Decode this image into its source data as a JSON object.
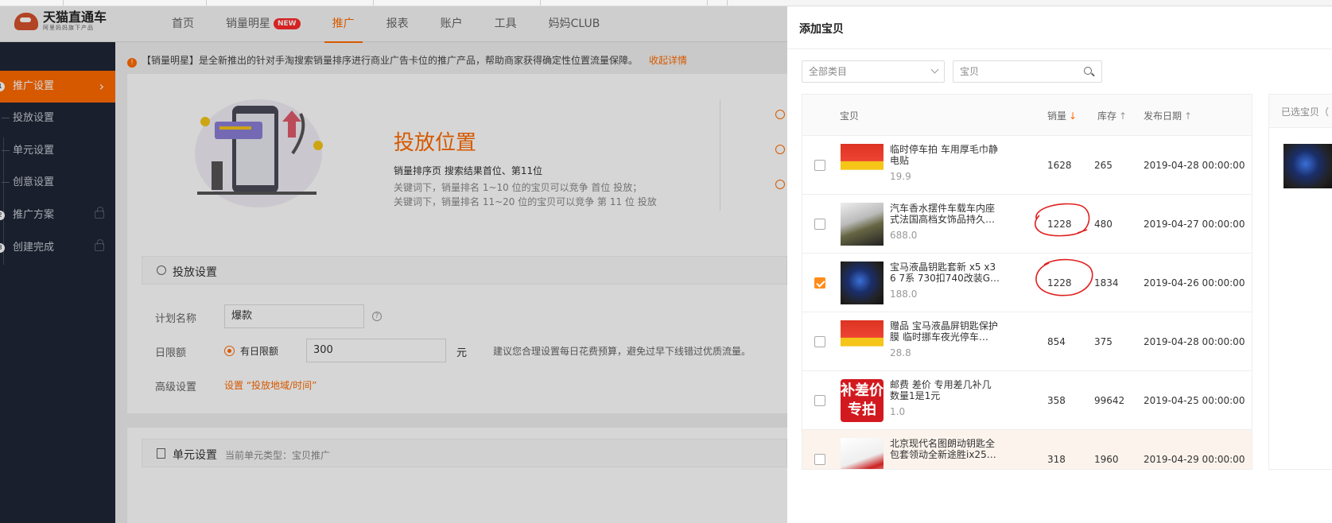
{
  "header": {
    "logo_title": "天猫直通车",
    "logo_sub": "阿里妈妈旗下产品",
    "nav": [
      {
        "label": "首页"
      },
      {
        "label": "销量明星",
        "badge": "NEW"
      },
      {
        "label": "推广",
        "active": true
      },
      {
        "label": "报表"
      },
      {
        "label": "账户"
      },
      {
        "label": "工具"
      },
      {
        "label": "妈妈CLUB"
      }
    ]
  },
  "sidebar": {
    "items": [
      {
        "num": "1",
        "label": "推广设置",
        "active": true
      },
      {
        "label": "投放设置"
      },
      {
        "label": "单元设置"
      },
      {
        "label": "创意设置"
      },
      {
        "num": "2",
        "label": "推广方案"
      },
      {
        "num": "3",
        "label": "创建完成"
      }
    ]
  },
  "main": {
    "notice": "【销量明星】是全新推出的针对手淘搜索销量排序进行商业广告卡位的推广产品，帮助商家获得确定性位置流量保障。",
    "notice_link": "收起详情",
    "hero_title": "投放位置",
    "hero_sub": "销量排序页 搜索结果首位、第11位",
    "hero_desc_1": "关键词下，销量排名 1~10 位的宝贝可以竞争 首位 投放；",
    "hero_desc_2": "关键词下，销量排名 11~20 位的宝贝可以竞争 第 11 位 投放",
    "section1_title": "投放设置",
    "plan_name_label": "计划名称",
    "plan_name_value": "爆款",
    "daily_label": "日限额",
    "daily_radio": "有日限额",
    "daily_value": "300",
    "daily_unit": "元",
    "daily_tip": "建议您合理设置每日花费预算，避免过早下线错过优质流量。",
    "advanced_label": "高级设置",
    "advanced_link": "设置 “投放地域/时间”",
    "section2_title": "单元设置",
    "section2_sub": "当前单元类型：宝贝推广"
  },
  "drawer": {
    "title": "添加宝贝",
    "category_placeholder": "全部类目",
    "search_placeholder": "宝贝",
    "columns": {
      "item": "宝贝",
      "sales": "销量",
      "stock": "库存",
      "date": "发布日期"
    },
    "rows": [
      {
        "name": "临时停车拍 车用厚毛巾静电贴",
        "price": "19.9",
        "sales": "1628",
        "stock": "265",
        "date": "2019-04-28 00:00:00",
        "checked": false
      },
      {
        "name": "汽车香水摆件车载车内座式法国高档女饰品持久…",
        "price": "688.0",
        "sales": "1228",
        "stock": "480",
        "date": "2019-04-27 00:00:00",
        "checked": false
      },
      {
        "name": "宝马液晶钥匙套新 x5 x3 6 7系 730扣740改装G…",
        "price": "188.0",
        "sales": "1228",
        "stock": "1834",
        "date": "2019-04-26 00:00:00",
        "checked": true
      },
      {
        "name": "赠品 宝马液晶屏钥匙保护膜 临时挪车夜光停车…",
        "price": "28.8",
        "sales": "854",
        "stock": "375",
        "date": "2019-04-28 00:00:00",
        "checked": false
      },
      {
        "name": "邮费 差价 专用差几补几 数量1是1元",
        "price": "1.0",
        "sales": "358",
        "stock": "99642",
        "date": "2019-04-25 00:00:00",
        "checked": false,
        "badge_text": "补差价专拍"
      },
      {
        "name": "北京现代名图朗动钥匙全包套领动全新途胜ix25…",
        "price": "",
        "sales": "318",
        "stock": "1960",
        "date": "2019-04-29 00:00:00",
        "checked": false
      }
    ],
    "selected_title": "已选宝贝（"
  },
  "colors": {
    "accent": "#ff6a00",
    "sidebar_bg": "#1e2536",
    "annotation": "#e0201f"
  }
}
